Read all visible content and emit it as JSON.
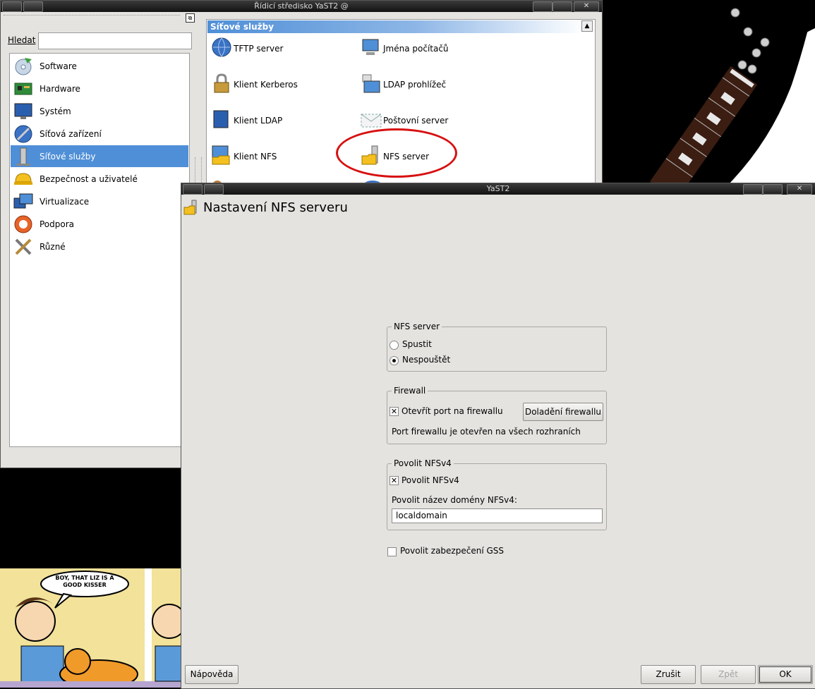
{
  "control_center": {
    "title": "Řídicí středisko YaST2 @",
    "search_label": "Hledat",
    "search_value": "",
    "categories": [
      {
        "label": "Software",
        "icon": "software-icon",
        "selected": false
      },
      {
        "label": "Hardware",
        "icon": "hardware-icon",
        "selected": false
      },
      {
        "label": "Systém",
        "icon": "system-icon",
        "selected": false
      },
      {
        "label": "Síťová zařízení",
        "icon": "network-devices-icon",
        "selected": false
      },
      {
        "label": "Síťové služby",
        "icon": "network-services-icon",
        "selected": true
      },
      {
        "label": "Bezpečnost a uživatelé",
        "icon": "security-icon",
        "selected": false
      },
      {
        "label": "Virtualizace",
        "icon": "virtualization-icon",
        "selected": false
      },
      {
        "label": "Podpora",
        "icon": "support-icon",
        "selected": false
      },
      {
        "label": "Různé",
        "icon": "misc-icon",
        "selected": false
      }
    ],
    "section_title": "Síťové služby",
    "modules": [
      {
        "label": "TFTP server",
        "icon": "globe-icon"
      },
      {
        "label": "Jména počítačů",
        "icon": "computer-icon"
      },
      {
        "label": "Klient Kerberos",
        "icon": "lock-icon"
      },
      {
        "label": "LDAP prohlížeč",
        "icon": "ldap-icon"
      },
      {
        "label": "Klient LDAP",
        "icon": "monitor-icon"
      },
      {
        "label": "Poštovní server",
        "icon": "mail-icon"
      },
      {
        "label": "Klient NFS",
        "icon": "folder-monitor-icon"
      },
      {
        "label": "NFS server",
        "icon": "folder-server-icon"
      }
    ]
  },
  "yast": {
    "window_title": "YaST2",
    "dialog_title": "Nastavení NFS serveru",
    "nfs_server": {
      "group_title": "NFS server",
      "start_label": "Spustit",
      "no_start_label": "Nespouštět",
      "selected": "Nespouštět"
    },
    "firewall": {
      "group_title": "Firewall",
      "open_port_label": "Otevřít port na firewallu",
      "open_port_checked": true,
      "details_button": "Doladění firewallu",
      "status_text": "Port firewallu je otevřen na všech rozhraních"
    },
    "nfsv4": {
      "group_title": "Povolit NFSv4",
      "enable_label": "Povolit NFSv4",
      "enable_checked": true,
      "domain_label": "Povolit název domény NFSv4:",
      "domain_value": "localdomain"
    },
    "gss": {
      "label": "Povolit zabezpečení GSS",
      "checked": false
    },
    "buttons": {
      "help": "Nápověda",
      "cancel": "Zrušit",
      "back": "Zpět",
      "ok": "OK"
    }
  },
  "comic": {
    "speech": "BOY, THAT LIZ IS A GOOD KISSER"
  },
  "colors": {
    "selection": "#4f8fd7",
    "annotation": "#d71010",
    "window_bg": "#e4e3e0"
  }
}
